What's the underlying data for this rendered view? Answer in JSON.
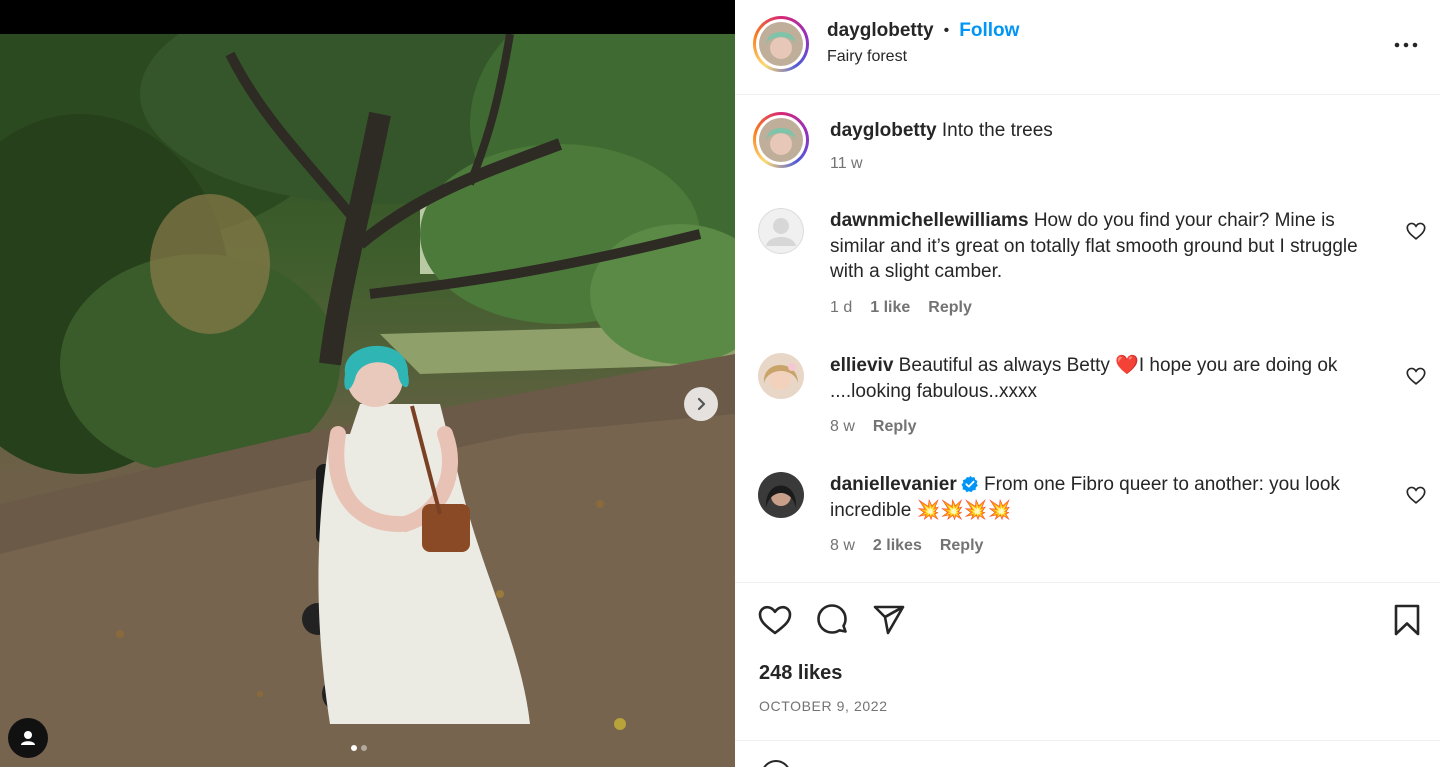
{
  "post": {
    "author": "dayglobetty",
    "follow_label": "Follow",
    "separator": "•",
    "location": "Fairy forest",
    "caption_user": "dayglobetty",
    "caption_text": "Into the trees",
    "caption_time": "11 w",
    "likes": "248 likes",
    "date": "OCTOBER 9, 2022",
    "carousel": {
      "total": 2,
      "active": 1
    }
  },
  "comments": [
    {
      "user": "dawnmichellewilliams",
      "text": "How do you find your chair? Mine is similar and it’s great on totally flat smooth ground but I struggle with a slight camber.",
      "time": "1 d",
      "likes": "1 like",
      "reply": "Reply",
      "verified": false
    },
    {
      "user": "ellieviv",
      "text": "Beautiful as always Betty ❤️I hope you are doing ok ....looking fabulous..xxxx",
      "time": "8 w",
      "likes": "",
      "reply": "Reply",
      "verified": false
    },
    {
      "user": "daniellevanier",
      "text": "From one Fibro queer to another: you look incredible 💥💥💥💥",
      "time": "8 w",
      "likes": "2 likes",
      "reply": "Reply",
      "verified": true
    }
  ],
  "icons": {
    "more": "more-options-icon",
    "like": "heart-icon",
    "comment": "comment-icon",
    "share": "share-icon",
    "save": "bookmark-icon",
    "next": "chevron-right-icon",
    "tags": "user-tag-icon",
    "verified": "verified-badge-icon"
  },
  "colors": {
    "follow": "#0095f6",
    "meta": "#737373",
    "text": "#262626",
    "verified": "#0095f6"
  }
}
